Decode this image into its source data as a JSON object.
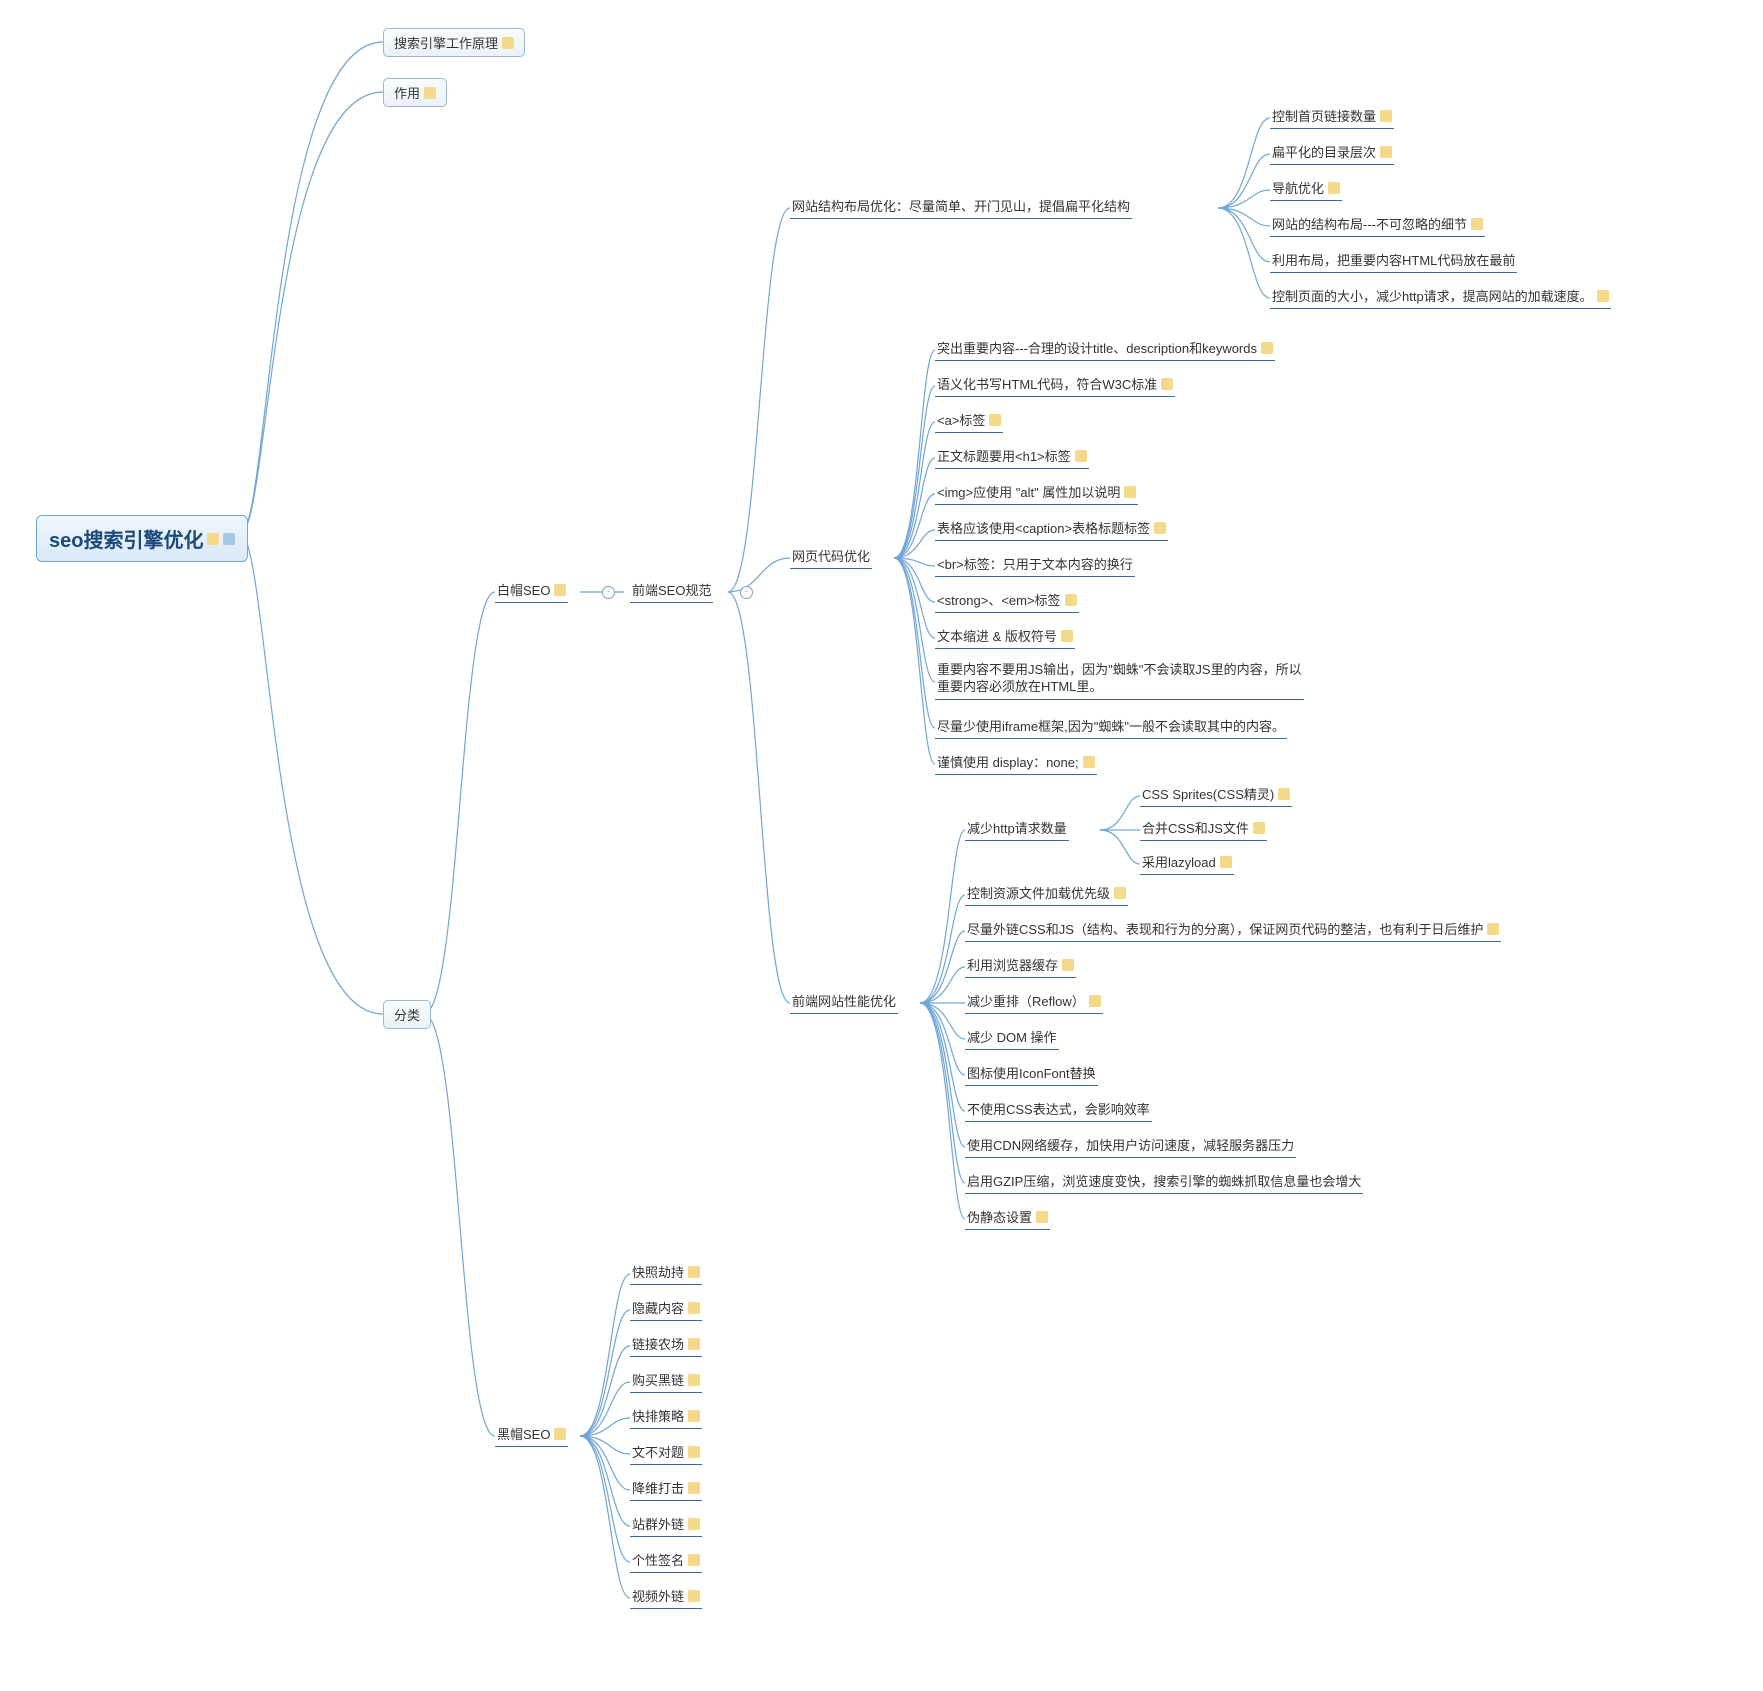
{
  "root": "seo搜索引擎优化",
  "l1": {
    "a": "搜索引擎工作原理",
    "b": "作用",
    "c": "分类"
  },
  "cat": {
    "white": "白帽SEO",
    "black": "黑帽SEO"
  },
  "white_sub": "前端SEO规范",
  "fe": {
    "struct": "网站结构布局优化：尽量简单、开门见山，提倡扁平化结构",
    "code": "网页代码优化",
    "perf": "前端网站性能优化"
  },
  "struct_items": [
    "控制首页链接数量",
    "扁平化的目录层次",
    "导航优化",
    "网站的结构布局---不可忽略的细节",
    "利用布局，把重要内容HTML代码放在最前",
    "控制页面的大小，减少http请求，提高网站的加载速度。"
  ],
  "code_items": [
    "突出重要内容---合理的设计title、description和keywords",
    "语义化书写HTML代码，符合W3C标准",
    "<a>标签",
    "正文标题要用<h1>标签",
    "<img>应使用 \"alt\" 属性加以说明",
    "表格应该使用<caption>表格标题标签",
    "<br>标签：只用于文本内容的换行",
    "<strong>、<em>标签",
    "文本缩进 & 版权符号",
    "重要内容不要用JS输出，因为\"蜘蛛\"不会读取JS里的内容，所以\n重要内容必须放在HTML里。",
    "尽量少使用iframe框架,因为\"蜘蛛\"一般不会读取其中的内容。",
    "谨慎使用 display：none;"
  ],
  "perf_http": "减少http请求数量",
  "perf_http_items": [
    "CSS Sprites(CSS精灵)",
    "合并CSS和JS文件",
    "采用lazyload"
  ],
  "perf_items": [
    "控制资源文件加载优先级",
    "尽量外链CSS和JS（结构、表现和行为的分离），保证网页代码的整洁，也有利于日后维护",
    "利用浏览器缓存",
    "减少重排（Reflow）",
    "减少 DOM 操作",
    "图标使用IconFont替换",
    "不使用CSS表达式，会影响效率",
    "使用CDN网络缓存，加快用户访问速度，减轻服务器压力",
    "启用GZIP压缩，浏览速度变快，搜索引擎的蜘蛛抓取信息量也会增大",
    "伪静态设置"
  ],
  "black_items": [
    "快照劫持",
    "隐藏内容",
    "链接农场",
    "购买黑链",
    "快排策略",
    "文不对题",
    "降维打击",
    "站群外链",
    "个性签名",
    "视频外链"
  ]
}
